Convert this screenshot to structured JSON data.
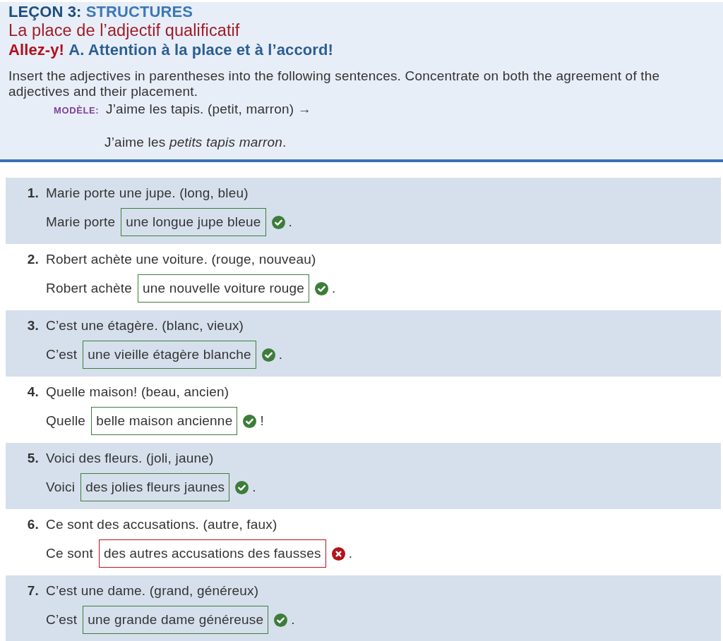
{
  "header": {
    "lesson_label": "LEÇON 3:",
    "lesson_section": "STRUCTURES",
    "topic": "La place de l’adjectif qualificatif",
    "activity_label": "Allez-y!",
    "activity_title": "A. Attention à la place et à l’accord!"
  },
  "instructions": "Insert the adjectives in parentheses into the following sentences. Concentrate on both the agreement of the adjectives and their placement.",
  "model": {
    "label": "MODÈLE:",
    "prompt": "J’aime les tapis. (petit, marron) →",
    "answer": "J’aime les *petits tapis marron*."
  },
  "items": [
    {
      "number": "1.",
      "prompt": "Marie porte une jupe. (long, bleu)",
      "answer_prefix": "Marie porte",
      "answer": "une longue jupe bleue",
      "correct": true,
      "punctuation": "."
    },
    {
      "number": "2.",
      "prompt": "Robert achète une voiture. (rouge, nouveau)",
      "answer_prefix": "Robert achète",
      "answer": "une nouvelle voiture rouge",
      "correct": true,
      "punctuation": "."
    },
    {
      "number": "3.",
      "prompt": "C’est une étagère. (blanc, vieux)",
      "answer_prefix": "C’est",
      "answer": "une vieille étagère blanche",
      "correct": true,
      "punctuation": "."
    },
    {
      "number": "4.",
      "prompt": "Quelle maison! (beau, ancien)",
      "answer_prefix": "Quelle",
      "answer": "belle maison ancienne",
      "correct": true,
      "punctuation": "!"
    },
    {
      "number": "5.",
      "prompt": "Voici des fleurs. (joli, jaune)",
      "answer_prefix": "Voici",
      "answer": "des jolies fleurs jaunes",
      "correct": true,
      "punctuation": "."
    },
    {
      "number": "6.",
      "prompt": "Ce sont des accusations. (autre, faux)",
      "answer_prefix": "Ce sont",
      "answer": "des autres accusations des fausses",
      "correct": false,
      "punctuation": "."
    },
    {
      "number": "7.",
      "prompt": "C’est une dame. (grand, généreux)",
      "answer_prefix": "C’est",
      "answer": "une grande dame généreuse",
      "correct": true,
      "punctuation": "."
    }
  ]
}
